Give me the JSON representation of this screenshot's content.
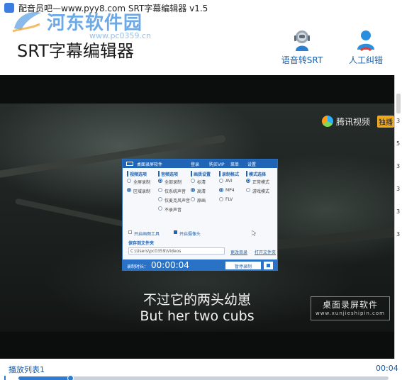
{
  "window": {
    "title": "配音员吧—www.pyy8.com SRT字幕编辑器 v1.5",
    "watermark_site": "河东软件园",
    "watermark_url": "www.pc0359.cn"
  },
  "header": {
    "app_heading": "SRT字幕编辑器",
    "speech_to_srt_label": "语音转SRT",
    "manual_fix_label": "人工纠错"
  },
  "video": {
    "channel_logo_text": "腾讯视频",
    "channel_logo_tag": "独播",
    "subtitle_cn": "不过它的两头幼崽",
    "subtitle_en": "But her two cubs",
    "brand_title": "桌面录屏软件",
    "brand_url": "www.xunjieshipin.com",
    "recorder": {
      "title": "桌面录屏软件",
      "menu": [
        "登录",
        "购买VIP",
        "菜单",
        "设置"
      ],
      "columns": [
        {
          "header": "视频选项",
          "options": [
            {
              "label": "全屏录制",
              "on": false
            },
            {
              "label": "区域录制",
              "on": true
            }
          ]
        },
        {
          "header": "音频选项",
          "options": [
            {
              "label": "全部录制",
              "on": true
            },
            {
              "label": "仅系统声音",
              "on": false
            },
            {
              "label": "仅麦克风声音",
              "on": false
            },
            {
              "label": "不录声音",
              "on": false
            }
          ]
        },
        {
          "header": "画质设置",
          "options": [
            {
              "label": "标清",
              "on": false
            },
            {
              "label": "高清",
              "on": true
            },
            {
              "label": "原画",
              "on": false
            }
          ]
        },
        {
          "header": "录制格式",
          "options": [
            {
              "label": "AVI",
              "on": false
            },
            {
              "label": "MP4",
              "on": true
            },
            {
              "label": "FLV",
              "on": false
            }
          ]
        },
        {
          "header": "模式选择",
          "options": [
            {
              "label": "正常模式",
              "on": true
            },
            {
              "label": "游戏模式",
              "on": false
            }
          ]
        }
      ],
      "check_1": "开启画图工具",
      "check_2": "开启摄像头",
      "folder_header": "保存到文件夹",
      "folder_path": "C:\\Users\\pc0359\\Videos",
      "change_dir": "更改目录",
      "open_folder": "打开文件夹",
      "duration_label": "录制时长：",
      "duration": "00:00:04",
      "pause_label": "暂停录制"
    }
  },
  "playback": {
    "playlist_label": "播放列表1",
    "time": "00:04",
    "progress": 0.14
  },
  "colors": {
    "accent": "#1a5ca8",
    "progress": "#2f7bd1",
    "recorder_blue": "#1f64b5"
  }
}
